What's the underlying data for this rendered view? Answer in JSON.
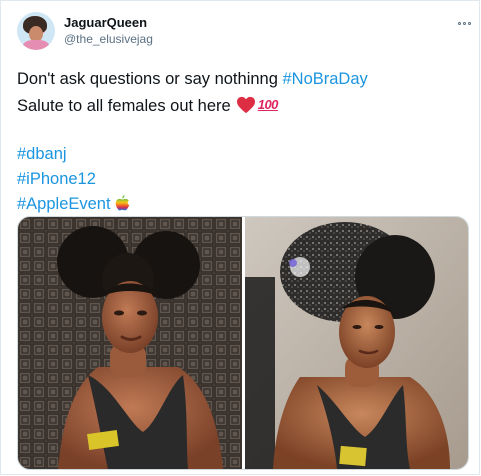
{
  "tweet": {
    "author": {
      "display_name": "JaguarQueen",
      "handle": "@the_elusivejag"
    },
    "text_line1": "Don't ask questions or say nothinng ",
    "hashtag_nobraday": "#NoBraDay",
    "text_line2": "Salute to all females out here",
    "hundred_emoji": "100",
    "hashtags": [
      "#dbanj",
      "#iPhone12",
      "#AppleEvent"
    ],
    "icons": {
      "more": "more-options-icon",
      "heart": "red-heart-emoji",
      "hundred": "hundred-points-emoji",
      "apple": "apple-logo-emoji"
    },
    "colors": {
      "link": "#1b95e0",
      "secondary_text": "#5b7083",
      "heart": "#e0245e"
    },
    "media_count": 2
  }
}
